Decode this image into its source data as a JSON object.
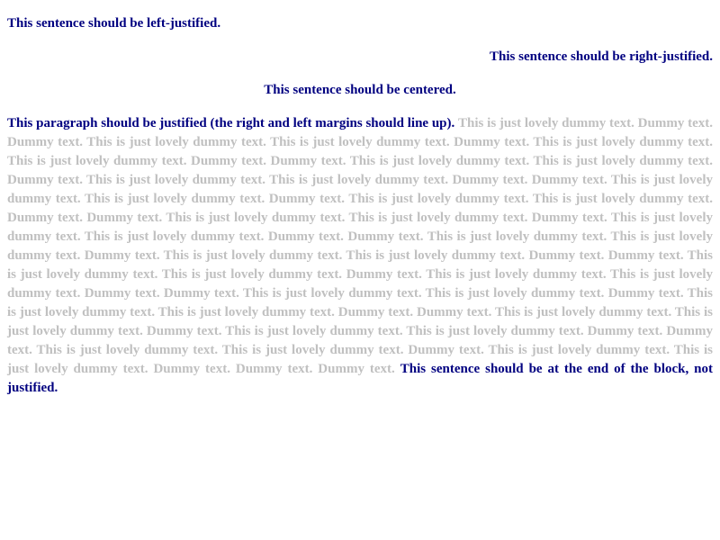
{
  "lines": {
    "left": "This sentence should be left-justified.",
    "right": "This sentence should be right-justified.",
    "center": "This sentence should be centered."
  },
  "paragraph": {
    "lead": "This paragraph should be justified (the right and left margins should line up).",
    "dummy": "This is just lovely dummy text. Dummy text. Dummy text. This is just lovely dummy text. This is just lovely dummy text. Dummy text. This is just lovely dummy text. This is just lovely dummy text. Dummy text. Dummy text. This is just lovely dummy text. This is just lovely dummy text. Dummy text. This is just lovely dummy text. This is just lovely dummy text. Dummy text. Dummy text. This is just lovely dummy text. This is just lovely dummy text. Dummy text. This is just lovely dummy text. This is just lovely dummy text. Dummy text. Dummy text. This is just lovely dummy text. This is just lovely dummy text. Dummy text. This is just lovely dummy text. This is just lovely dummy text. Dummy text. Dummy text. This is just lovely dummy text. This is just lovely dummy text. Dummy text. This is just lovely dummy text. This is just lovely dummy text. Dummy text. Dummy text. This is just lovely dummy text. This is just lovely dummy text. Dummy text. This is just lovely dummy text. This is just lovely dummy text. Dummy text. Dummy text. This is just lovely dummy text. This is just lovely dummy text. Dummy text. This is just lovely dummy text. This is just lovely dummy text. Dummy text. Dummy text. This is just lovely dummy text. This is just lovely dummy text. Dummy text. This is just lovely dummy text. This is just lovely dummy text. Dummy text. Dummy text. This is just lovely dummy text. This is just lovely dummy text. Dummy text. This is just lovely dummy text. This is just lovely dummy text. Dummy text. Dummy text. Dummy text.",
    "tail": "This sentence should be at the end of the block, not justified."
  },
  "colors": {
    "text": "#000080",
    "dummy": "#c0c0c0",
    "background": "#ffffff"
  }
}
